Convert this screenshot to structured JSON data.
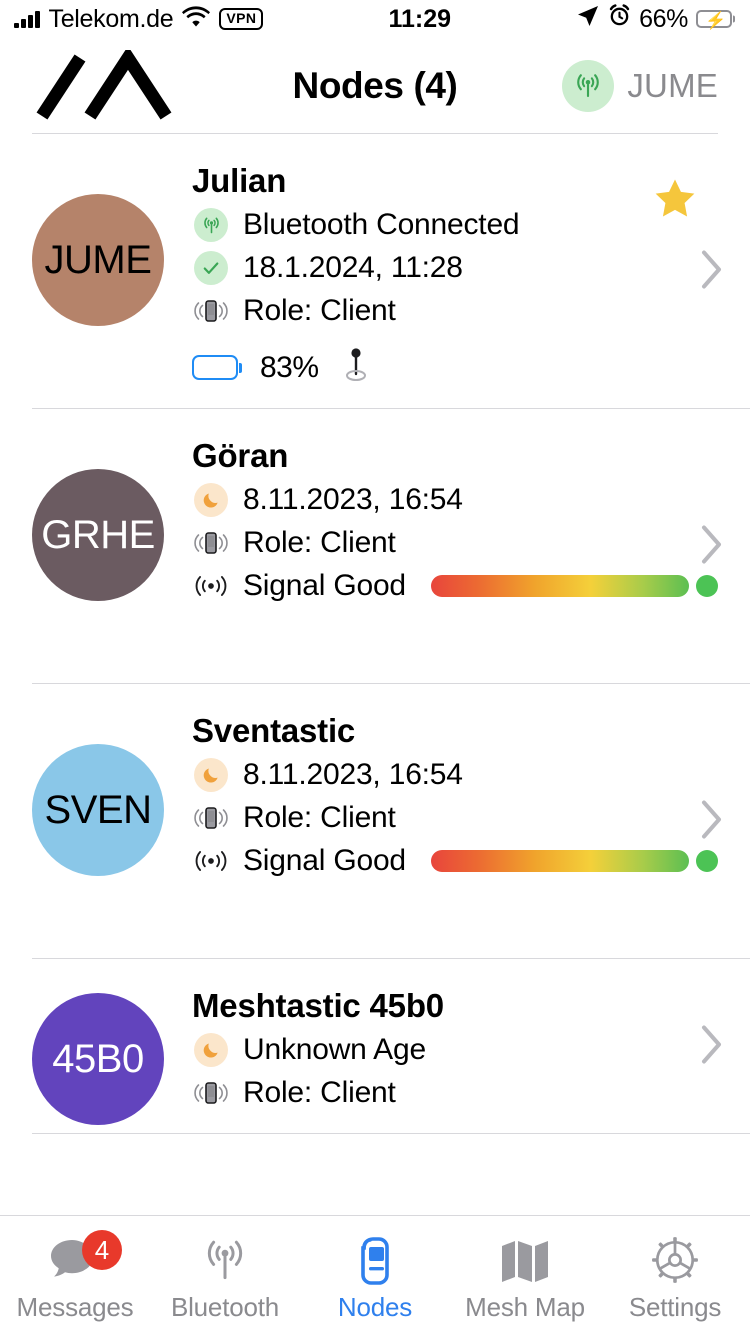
{
  "status_bar": {
    "carrier": "Telekom.de",
    "vpn_label": "VPN",
    "time": "11:29",
    "battery_percent": "66%",
    "signal_icon": "cellular-bars-icon",
    "wifi_icon": "wifi-icon",
    "location_icon": "location-arrow-icon",
    "alarm_icon": "alarm-clock-icon",
    "battery_icon": "battery-charging-icon"
  },
  "nav": {
    "title": "Nodes (4)",
    "logo_icon": "meshtastic-logo-icon",
    "connection_icon": "antenna-icon",
    "connected_node": "JUME"
  },
  "nodes": [
    {
      "initials": "JUME",
      "avatar_color": "#b5836a",
      "avatar_text_color": "#000000",
      "name": "Julian",
      "favorite": true,
      "star_color": "#f5c63c",
      "rows": [
        {
          "icon": "bluetooth-antenna-icon",
          "icon_style": "green-badge",
          "text": "Bluetooth Connected"
        },
        {
          "icon": "check-icon",
          "icon_style": "green-badge",
          "text": "18.1.2024, 11:28"
        },
        {
          "icon": "phone-waves-icon",
          "icon_style": "plain",
          "text": "Role: Client"
        }
      ],
      "battery": {
        "percent_label": "83%",
        "level": 83,
        "color": "#1f8cf5"
      },
      "location_icon": "map-pin-icon",
      "signal": null,
      "chevron": "chevron-right-icon"
    },
    {
      "initials": "GRHE",
      "avatar_color": "#6b5b61",
      "avatar_text_color": "#ffffff",
      "name": "Göran",
      "favorite": false,
      "rows": [
        {
          "icon": "moon-icon",
          "icon_style": "orange-badge",
          "text": "8.11.2023, 16:54"
        },
        {
          "icon": "phone-waves-icon",
          "icon_style": "plain",
          "text": "Role: Client"
        }
      ],
      "battery": null,
      "signal": {
        "label": "Signal Good",
        "icon": "signal-waves-icon",
        "level": 100,
        "knob_color": "#4cc355"
      },
      "chevron": "chevron-right-icon"
    },
    {
      "initials": "SVEN",
      "avatar_color": "#8ac7e8",
      "avatar_text_color": "#000000",
      "name": "Sventastic",
      "favorite": false,
      "rows": [
        {
          "icon": "moon-icon",
          "icon_style": "orange-badge",
          "text": "8.11.2023, 16:54"
        },
        {
          "icon": "phone-waves-icon",
          "icon_style": "plain",
          "text": "Role: Client"
        }
      ],
      "battery": null,
      "signal": {
        "label": "Signal Good",
        "icon": "signal-waves-icon",
        "level": 100,
        "knob_color": "#4cc355"
      },
      "chevron": "chevron-right-icon"
    },
    {
      "initials": "45B0",
      "avatar_color": "#6244bd",
      "avatar_text_color": "#ffffff",
      "name": "Meshtastic 45b0",
      "favorite": false,
      "rows": [
        {
          "icon": "moon-icon",
          "icon_style": "orange-badge",
          "text": "Unknown Age"
        },
        {
          "icon": "phone-waves-icon",
          "icon_style": "plain",
          "text": "Role: Client"
        }
      ],
      "battery": null,
      "signal": null,
      "chevron": "chevron-right-icon"
    }
  ],
  "tabbar": {
    "active_color": "#2f80ed",
    "inactive_color": "#8a8a8e",
    "tabs": [
      {
        "label": "Messages",
        "icon": "speech-bubble-icon",
        "badge": "4",
        "active": false
      },
      {
        "label": "Bluetooth",
        "icon": "antenna-icon",
        "badge": null,
        "active": false
      },
      {
        "label": "Nodes",
        "icon": "mobile-phone-icon",
        "badge": null,
        "active": true
      },
      {
        "label": "Mesh Map",
        "icon": "map-icon",
        "badge": null,
        "active": false
      },
      {
        "label": "Settings",
        "icon": "gear-icon",
        "badge": null,
        "active": false
      }
    ]
  }
}
